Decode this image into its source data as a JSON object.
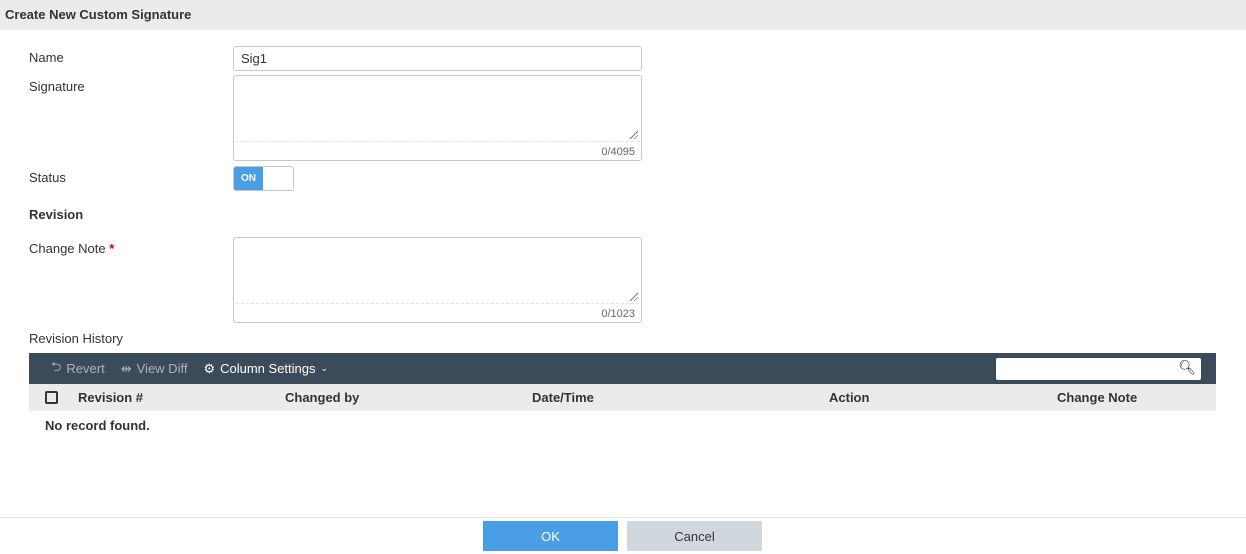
{
  "header": {
    "title": "Create New Custom Signature"
  },
  "form": {
    "name_label": "Name",
    "name_value": "Sig1",
    "signature_label": "Signature",
    "signature_count": "0/4095",
    "status_label": "Status",
    "status_toggle": "ON",
    "revision_heading": "Revision",
    "change_note_label": "Change Note",
    "required_mark": "*",
    "change_note_count": "0/1023",
    "revision_history_label": "Revision History"
  },
  "toolbar": {
    "revert": "Revert",
    "view_diff": "View Diff",
    "column_settings": "Column Settings",
    "search_placeholder": ""
  },
  "table": {
    "columns": [
      "Revision #",
      "Changed by",
      "Date/Time",
      "Action",
      "Change Note"
    ],
    "empty": "No record found."
  },
  "footer": {
    "ok": "OK",
    "cancel": "Cancel"
  },
  "colors": {
    "accent": "#4a9ee6",
    "toolbar": "#3c4b5a"
  }
}
